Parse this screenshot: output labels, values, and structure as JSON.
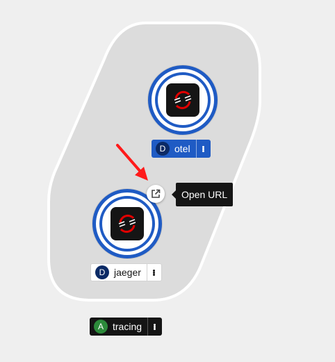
{
  "group": {
    "badge": "A",
    "name": "tracing",
    "badge_color": "#2c8a3a"
  },
  "nodes": [
    {
      "badge": "D",
      "name": "otel",
      "icon": "openshift-logo-icon",
      "selected": true
    },
    {
      "badge": "D",
      "name": "jaeger",
      "icon": "openshift-logo-icon",
      "selected": false
    }
  ],
  "url_decorator": {
    "icon": "external-link-icon",
    "tooltip": "Open URL"
  },
  "annotation": {
    "icon": "red-arrow-icon",
    "color": "#ff1a1a"
  },
  "colors": {
    "accent": "#1f5bc4",
    "badge_dark": "#0b2a66",
    "group_fill": "#dcdcdc"
  }
}
